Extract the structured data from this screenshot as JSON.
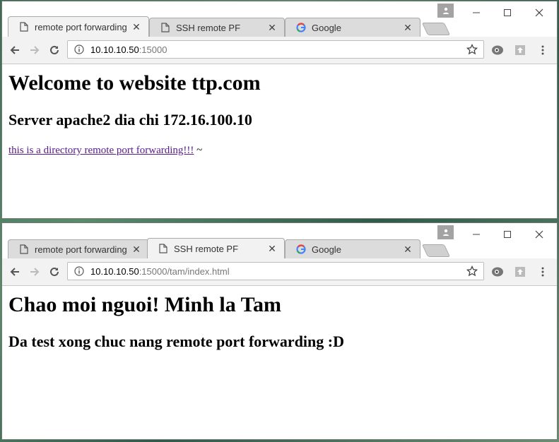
{
  "windows": [
    {
      "tabs": [
        {
          "label": "remote port forwarding",
          "icon": "page-icon",
          "active": true
        },
        {
          "label": "SSH remote PF",
          "icon": "page-icon",
          "active": false
        },
        {
          "label": "Google",
          "icon": "google-icon",
          "active": false
        }
      ],
      "address": {
        "host": "10.10.10.50",
        "rest": ":15000"
      },
      "content": {
        "heading": "Welcome to website ttp.com",
        "subheading": "Server apache2 dia chi 172.16.100.10",
        "link_text": "this is a directory remote port forwarding!!!",
        "link_suffix": " ~"
      }
    },
    {
      "tabs": [
        {
          "label": "remote port forwarding",
          "icon": "page-icon",
          "active": false
        },
        {
          "label": "SSH remote PF",
          "icon": "page-icon",
          "active": true
        },
        {
          "label": "Google",
          "icon": "google-icon",
          "active": false
        }
      ],
      "address": {
        "host": "10.10.10.50",
        "rest": ":15000/tam/index.html"
      },
      "content": {
        "heading": "Chao moi nguoi! Minh la Tam",
        "subheading": "Da test xong chuc nang remote port forwarding :D"
      }
    }
  ],
  "colors": {
    "link_visited": "#5a1a8b",
    "tab_active": "#f2f2f2",
    "tab_inactive": "#dcdcdc",
    "toolbar": "#f2f2f2"
  }
}
